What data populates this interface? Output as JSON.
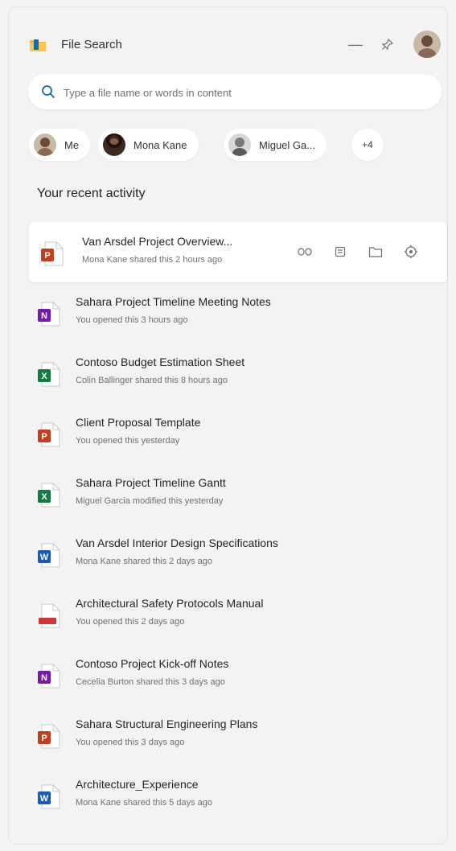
{
  "app": {
    "title": "File Search",
    "colors": {
      "brand": "#f2b33d",
      "accent": "#0f6cbd"
    }
  },
  "header": {
    "minimize_label": "—",
    "pin_icon": "pin-icon"
  },
  "search": {
    "placeholder": "Type a file name or words in content",
    "value": ""
  },
  "people": [
    {
      "label": "Me"
    },
    {
      "label": "Mona Kane"
    },
    {
      "label": "Miguel Ga..."
    }
  ],
  "more_people_label": "+4",
  "recent": {
    "title": "Your recent activity",
    "items": [
      {
        "name": "Van Arsdel Project Overview...",
        "sub": "Mona Kane shared this 2 hours ago",
        "type": "powerpoint",
        "color": "#c43e1c"
      },
      {
        "name": "Sahara Project Timeline Meeting Notes",
        "sub": "You opened this 3 hours ago",
        "type": "onenote",
        "color": "#7719aa"
      },
      {
        "name": "Contoso Budget Estimation Sheet",
        "sub": "Colin Ballinger shared this 8 hours ago",
        "type": "excel",
        "color": "#107c41"
      },
      {
        "name": "Client Proposal Template",
        "sub": "You opened this yesterday",
        "type": "powerpoint",
        "color": "#c43e1c"
      },
      {
        "name": "Sahara Project Timeline Gantt",
        "sub": "Miguel Garcia modified this yesterday",
        "type": "excel",
        "color": "#107c41"
      },
      {
        "name": "Van Arsdel Interior Design Specifications",
        "sub": "Mona Kane shared this 2 days ago",
        "type": "word",
        "color": "#185abd"
      },
      {
        "name": "Architectural Safety Protocols Manual",
        "sub": "You opened this 2 days ago",
        "type": "pdf",
        "color": "#d13438"
      },
      {
        "name": "Contoso Project Kick-off Notes",
        "sub": "Cecelia Burton shared this 3 days ago",
        "type": "onenote",
        "color": "#7719aa"
      },
      {
        "name": "Sahara Structural Engineering Plans",
        "sub": "You opened this 3 days ago",
        "type": "powerpoint",
        "color": "#c43e1c"
      },
      {
        "name": "Architecture_Experience",
        "sub": "Mona Kane shared this 5 days ago",
        "type": "word",
        "color": "#185abd"
      }
    ]
  },
  "hover_actions": [
    "share-icon",
    "copy-link-icon",
    "open-folder-icon",
    "more-options-icon"
  ]
}
